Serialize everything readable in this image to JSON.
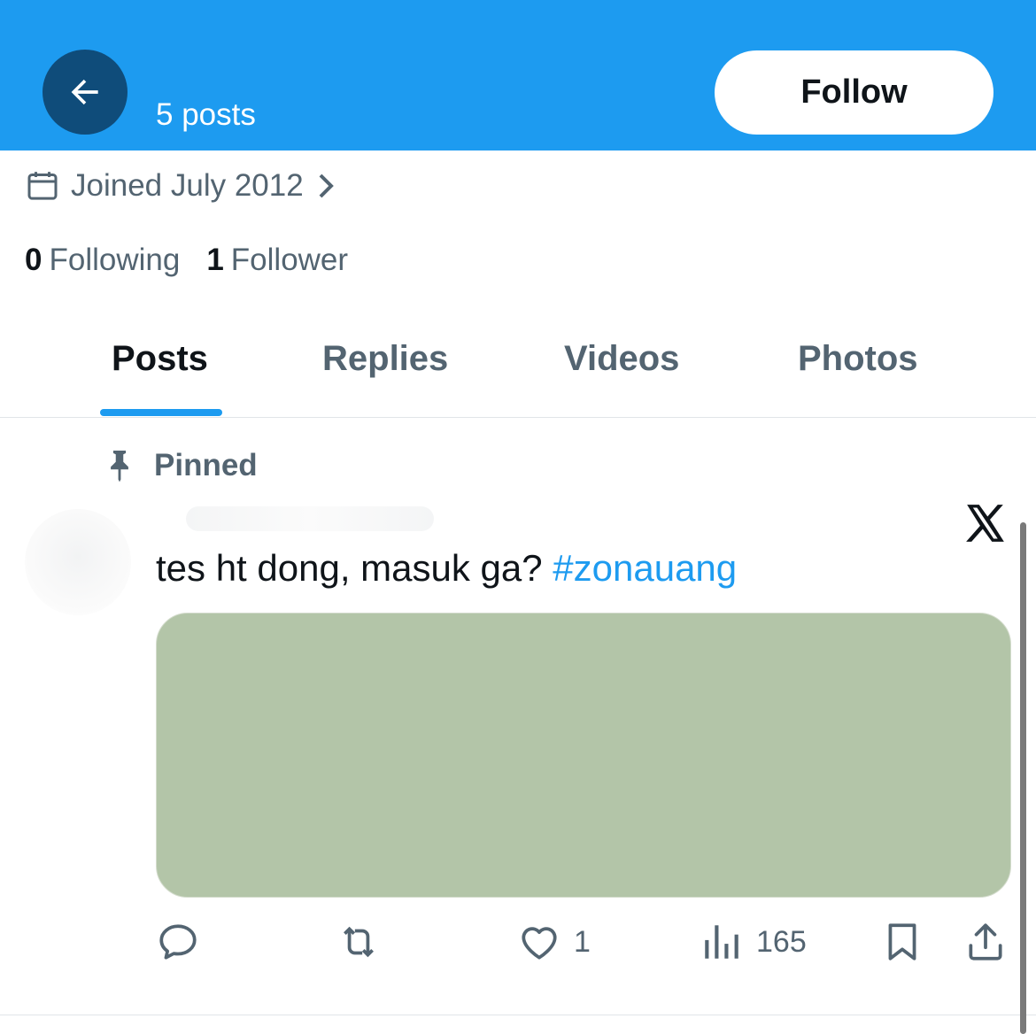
{
  "header": {
    "posts_count": "5 posts",
    "follow_label": "Follow",
    "bg_color": "#1d9bf0"
  },
  "profile": {
    "joined": "Joined July 2012",
    "following_count": "0",
    "following_label": "Following",
    "followers_count": "1",
    "followers_label": "Follower"
  },
  "tabs": [
    {
      "label": "Posts",
      "active": true
    },
    {
      "label": "Replies",
      "active": false
    },
    {
      "label": "Videos",
      "active": false
    },
    {
      "label": "Photos",
      "active": false
    }
  ],
  "post": {
    "pinned_label": "Pinned",
    "text": "tes ht dong, masuk ga? ",
    "hashtag": "#zonauang",
    "media_color": "#b3c5a8",
    "actions": {
      "reply_count": "",
      "repost_count": "",
      "like_count": "1",
      "views_count": "165"
    }
  },
  "icons": [
    "back-arrow-icon",
    "calendar-icon",
    "chevron-right-icon",
    "pin-icon",
    "x-logo-icon",
    "reply-icon",
    "repost-icon",
    "heart-icon",
    "views-icon",
    "bookmark-icon",
    "share-icon"
  ]
}
